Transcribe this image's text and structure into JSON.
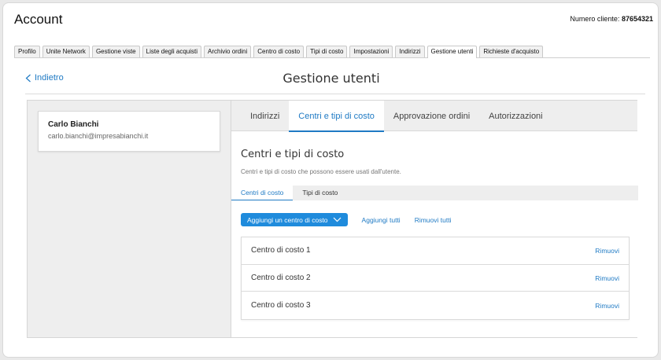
{
  "header": {
    "title": "Account",
    "client_label": "Numero cliente:",
    "client_number": "87654321"
  },
  "top_tabs": [
    {
      "label": "Profilo"
    },
    {
      "label": "Unite Network"
    },
    {
      "label": "Gestione viste"
    },
    {
      "label": "Liste degli acquisti"
    },
    {
      "label": "Archivio ordini"
    },
    {
      "label": "Centro di costo"
    },
    {
      "label": "Tipi di costo"
    },
    {
      "label": "Impostazioni"
    },
    {
      "label": "Indirizzi"
    },
    {
      "label": "Gestione utenti",
      "active": true
    },
    {
      "label": "Richieste d'acquisto"
    }
  ],
  "page": {
    "back_label": "Indietro",
    "title": "Gestione utenti"
  },
  "user": {
    "name": "Carlo Bianchi",
    "email": "carlo.bianchi@impresabianchi.it"
  },
  "section_tabs": [
    {
      "label": "Indirizzi"
    },
    {
      "label": "Centri e tipi di costo",
      "active": true
    },
    {
      "label": "Approvazione ordini"
    },
    {
      "label": "Autorizzazioni"
    }
  ],
  "content": {
    "title": "Centri e tipi di costo",
    "description": "Centri e tipi di costo che possono essere usati dall'utente."
  },
  "sub_tabs": [
    {
      "label": "Centri di costo",
      "active": true
    },
    {
      "label": "Tipi di costo"
    }
  ],
  "actions": {
    "add_label": "Aggiungi un centro di costo",
    "add_all_label": "Aggiungi tutti",
    "remove_all_label": "Rimuovi tutti"
  },
  "cost_centers": [
    {
      "label": "Centro di costo 1",
      "action": "Rimuovi"
    },
    {
      "label": "Centro di costo 2",
      "action": "Rimuovi"
    },
    {
      "label": "Centro di costo 3",
      "action": "Rimuovi"
    }
  ],
  "colors": {
    "accent": "#1f7ac4",
    "button": "#1f8bdc"
  }
}
